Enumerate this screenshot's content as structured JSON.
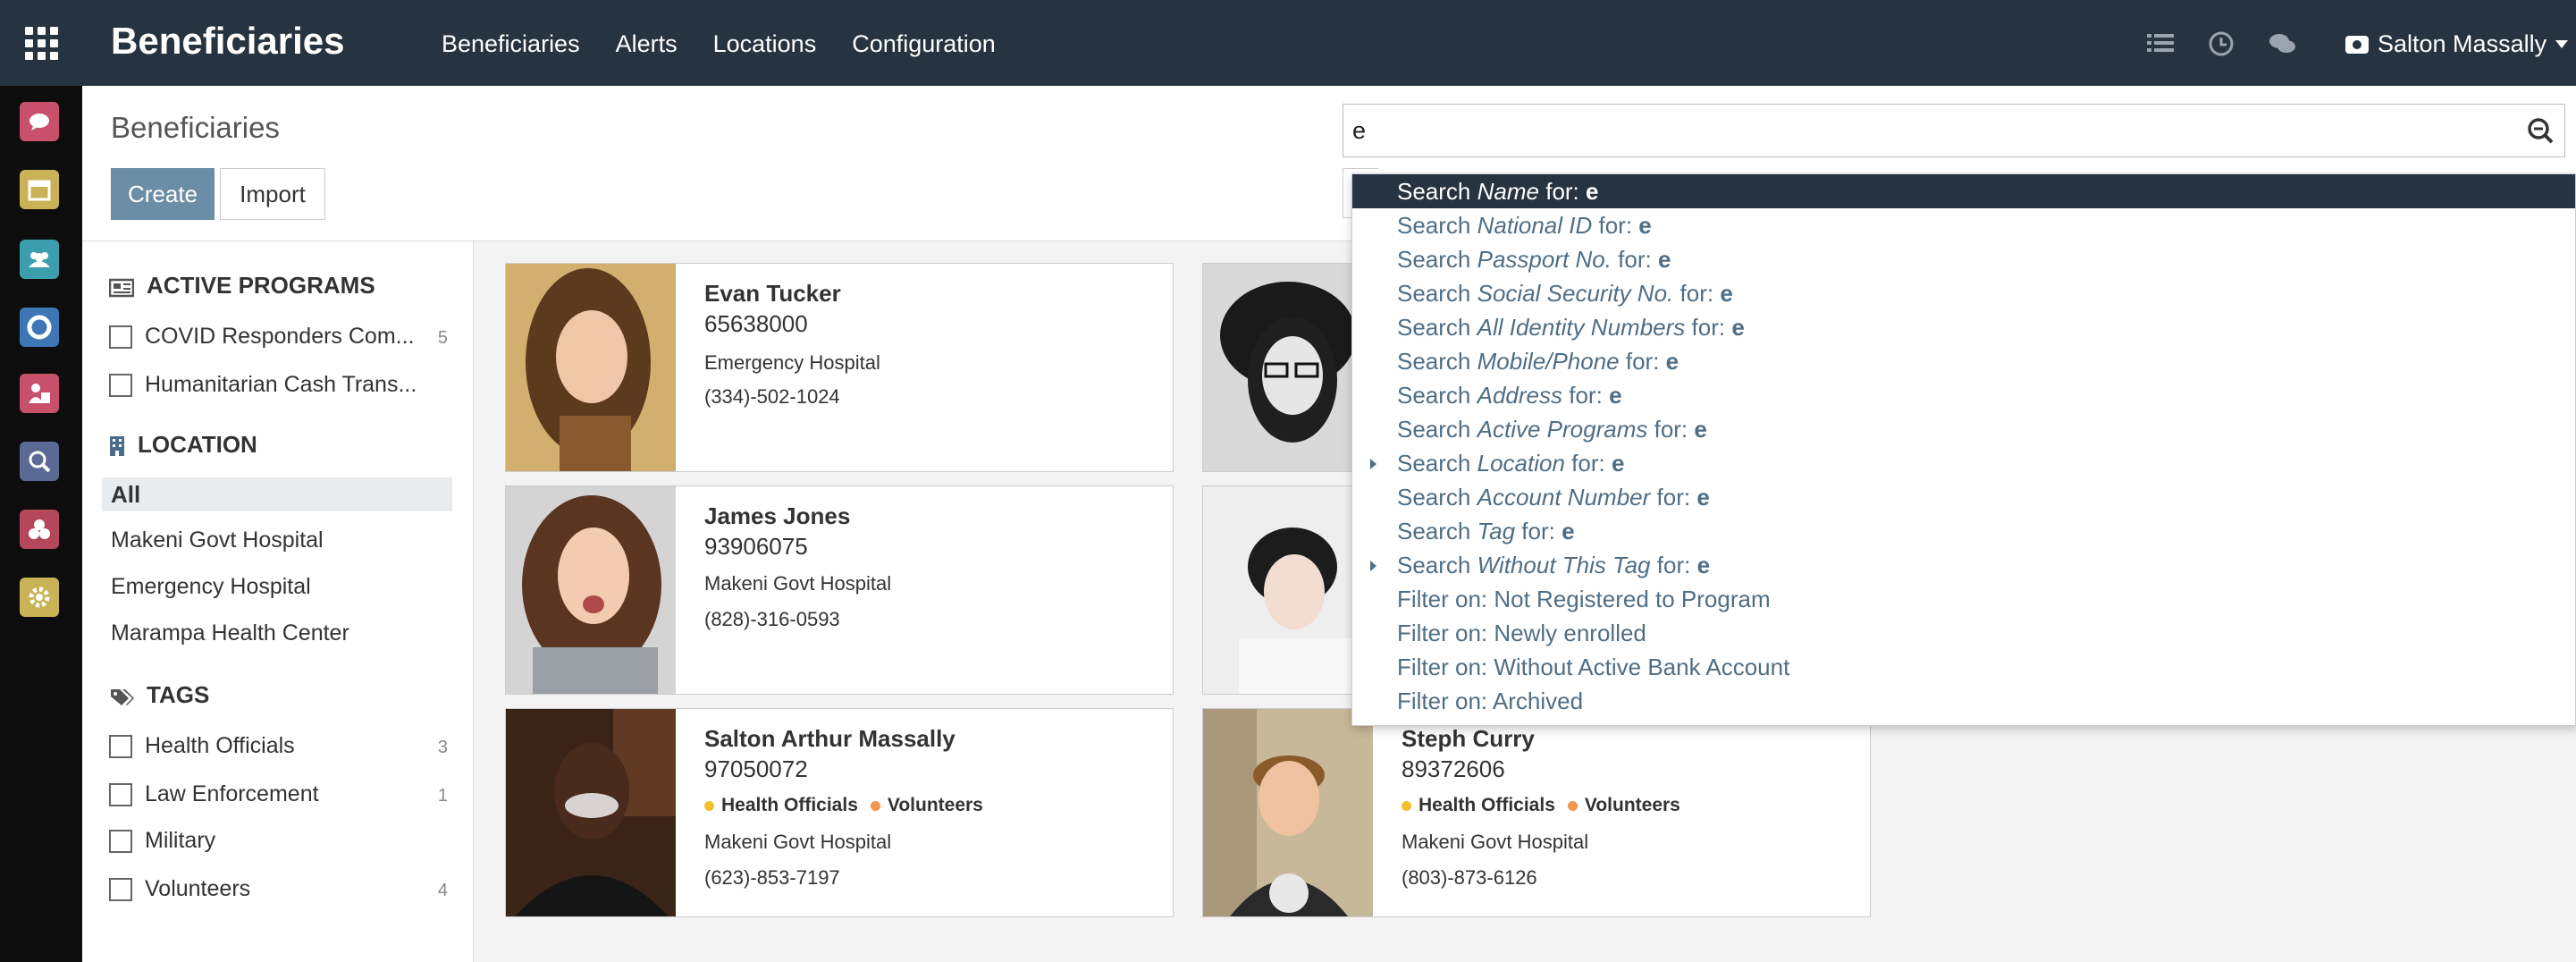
{
  "navbar": {
    "brand": "Beneficiaries",
    "menu": [
      "Beneficiaries",
      "Alerts",
      "Locations",
      "Configuration"
    ],
    "user": "Salton Massally"
  },
  "control": {
    "title": "Beneficiaries",
    "create_label": "Create",
    "import_label": "Import",
    "search_value": "e"
  },
  "searchpanel": {
    "programs_title": "ACTIVE PROGRAMS",
    "programs": [
      {
        "label": "COVID Responders Com...",
        "count": "5"
      },
      {
        "label": "Humanitarian Cash Trans...",
        "count": ""
      }
    ],
    "location_title": "LOCATION",
    "locations": [
      "All",
      "Makeni Govt Hospital",
      "Emergency Hospital",
      "Marampa Health Center"
    ],
    "tags_title": "TAGS",
    "tags": [
      {
        "label": "Health Officials",
        "count": "3"
      },
      {
        "label": "Law Enforcement",
        "count": "1"
      },
      {
        "label": "Military",
        "count": ""
      },
      {
        "label": "Volunteers",
        "count": "4"
      }
    ]
  },
  "cards": [
    {
      "name": "Evan Tucker",
      "number": "65638000",
      "location": "Emergency Hospital",
      "phone": "(334)-502-1024"
    },
    {
      "name": "James Jones",
      "number": "93906075",
      "location": "Makeni Govt Hospital",
      "phone": "(828)-316-0593"
    },
    {
      "name": "Salton Arthur Massally",
      "number": "97050072",
      "tags": [
        "Health Officials",
        "Volunteers"
      ],
      "location": "Makeni Govt Hospital",
      "phone": "(623)-853-7197"
    },
    {
      "name": "Steph Curry",
      "number": "89372606",
      "tags": [
        "Health Officials",
        "Volunteers"
      ],
      "location": "Makeni Govt Hospital",
      "phone": "(803)-873-6126"
    }
  ],
  "dropdown": {
    "search_prefix": "Search",
    "for_label": "for:",
    "term": "e",
    "fields": [
      "Name",
      "National ID",
      "Passport No.",
      "Social Security No.",
      "All Identity Numbers",
      "Mobile/Phone",
      "Address",
      "Active Programs",
      "Location",
      "Account Number",
      "Tag",
      "Without This Tag"
    ],
    "filters": [
      "Filter on: Not Registered to Program",
      "Filter on: Newly enrolled",
      "Filter on: Without Active Bank Account",
      "Filter on: Archived"
    ]
  },
  "colors": {
    "navbar": "#263340",
    "primary": "#6b8ea6",
    "tag_health": "#f0c12c",
    "tag_volunteers": "#f0954b",
    "dropdown_text": "#4f6e85"
  }
}
